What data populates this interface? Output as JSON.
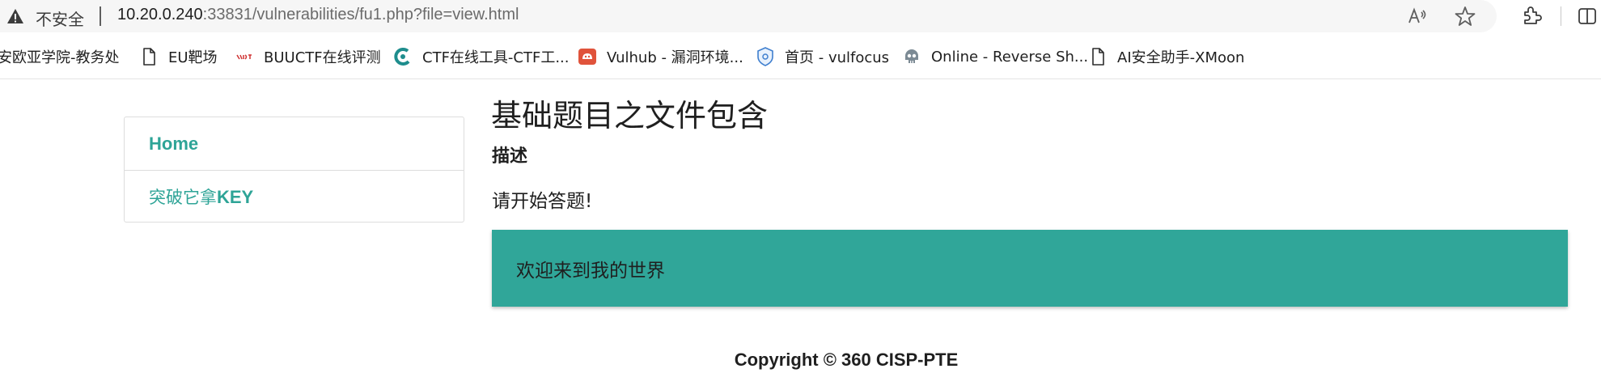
{
  "browser": {
    "insecure_label": "不安全",
    "url_host": "10.20.0.240",
    "url_rest": ":33831/vulnerabilities/fu1.php?file=view.html",
    "icons": [
      "warning-icon",
      "read-aloud-icon",
      "favorite-star-icon",
      "extensions-icon",
      "split-screen-icon"
    ]
  },
  "bookmarks": [
    {
      "label": "安欧亚学院-教务处",
      "icon": "none"
    },
    {
      "label": "EU靶场",
      "icon": "page-icon"
    },
    {
      "label": "BUUCTF在线评测",
      "icon": "buuctf-icon"
    },
    {
      "label": "CTF在线工具-CTF工...",
      "icon": "ctf-tools-icon"
    },
    {
      "label": "Vulhub - 漏洞环境...",
      "icon": "vulhub-icon"
    },
    {
      "label": "首页 - vulfocus",
      "icon": "vulfocus-icon"
    },
    {
      "label": "Online - Reverse Sh...",
      "icon": "skull-icon"
    },
    {
      "label": "AI安全助手-XMoon",
      "icon": "page-icon"
    }
  ],
  "sidebar": {
    "items": [
      {
        "label": "Home",
        "active": true
      },
      {
        "label_prefix": "突破它拿",
        "label_suffix": "KEY",
        "active": false
      }
    ]
  },
  "main": {
    "title": "基础题目之文件包含",
    "description_heading": "描述",
    "description_text": "请开始答题!",
    "welcome_text": "欢迎来到我的世界"
  },
  "footer": {
    "copyright": "Copyright © 360 CISP-PTE"
  },
  "colors": {
    "accent": "#2ea497",
    "panel": "#30a699"
  }
}
